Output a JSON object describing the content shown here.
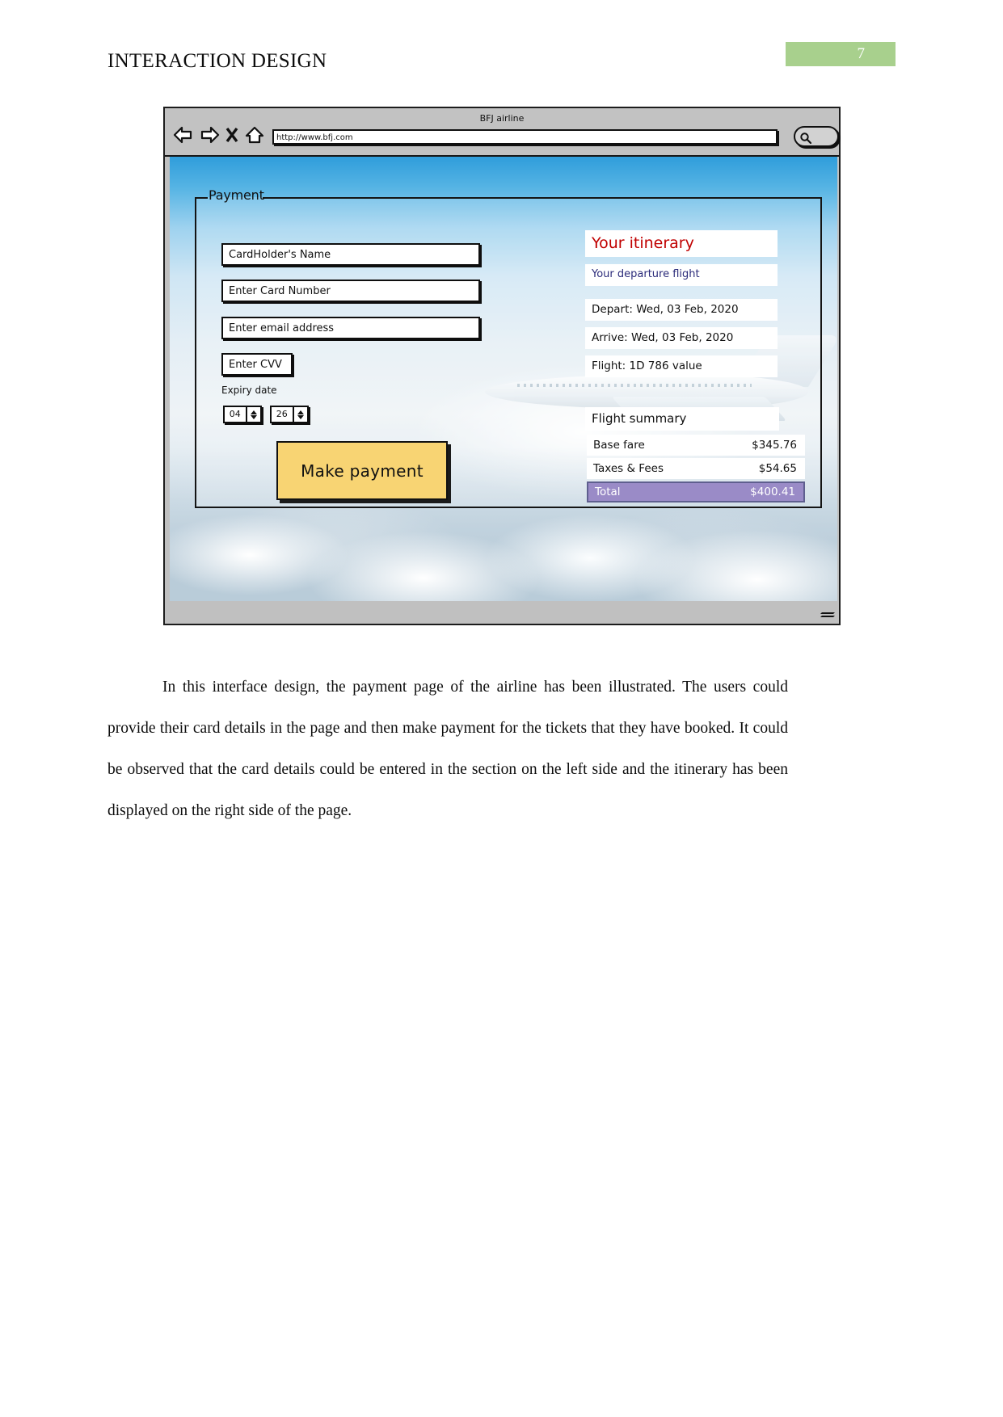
{
  "document": {
    "header_title": "INTERACTION DESIGN",
    "page_number": "7"
  },
  "browser": {
    "window_title": "BFJ airline",
    "url_value": "http://www.bfj.com",
    "nav_icons": [
      "back-arrow-icon",
      "forward-arrow-icon",
      "stop-x-icon",
      "home-icon"
    ],
    "search_icon": "search-icon"
  },
  "payment_panel": {
    "legend": "Payment",
    "fields": {
      "cardholder_name": "CardHolder's Name",
      "card_number": "Enter Card Number",
      "email": "Enter email address",
      "cvv": "Enter CVV"
    },
    "expiry": {
      "label": "Expiry date",
      "month": "04",
      "year": "26"
    },
    "submit_label": "Make payment"
  },
  "itinerary": {
    "title": "Your itinerary",
    "title_color": "#c00000",
    "subtitle": "Your departure flight",
    "subtitle_color": "#2b2b7a",
    "depart": "Depart: Wed, 03 Feb, 2020",
    "arrive": "Arrive: Wed, 03 Feb, 2020",
    "flight": "Flight: 1D 786 value"
  },
  "flight_summary": {
    "heading": "Flight summary",
    "rows": [
      {
        "label": "Base fare",
        "value": "$345.76"
      },
      {
        "label": "Taxes & Fees",
        "value": "$54.65"
      }
    ],
    "total": {
      "label": "Total",
      "value": "$400.41",
      "highlight_color": "#9a8bc7"
    }
  },
  "body": {
    "paragraph": "In this interface design, the payment page of the airline has been illustrated. The users could provide their card details in the page and then make payment for the tickets that they have booked. It could be observed that the card details could be entered in the section on the left side and the itinerary has been displayed on the right side of the page."
  }
}
